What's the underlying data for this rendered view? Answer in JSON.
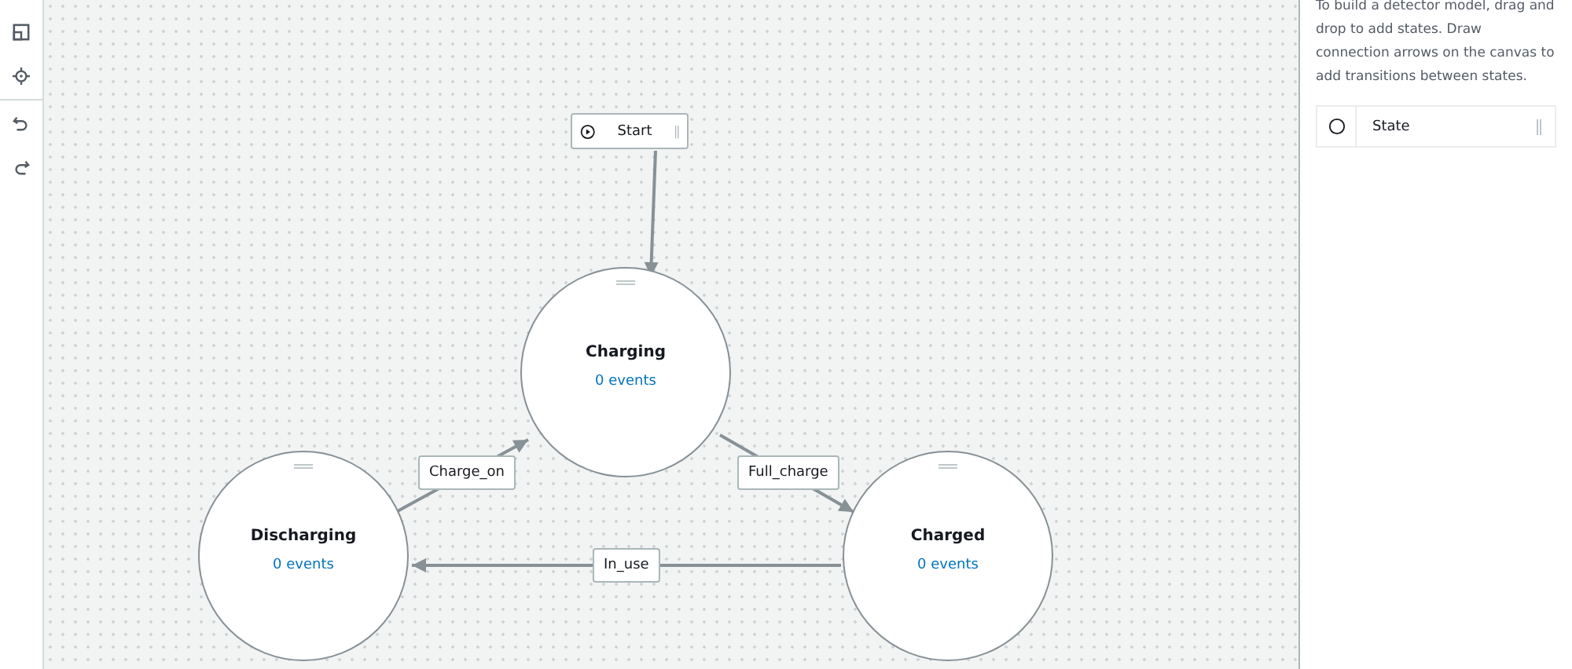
{
  "toolbar": [
    {
      "kind": "fit"
    },
    {
      "kind": "center"
    },
    {
      "kind": "undo"
    },
    {
      "kind": "redo"
    }
  ],
  "canvas": {
    "start": {
      "label": "Start"
    },
    "states": [
      {
        "name": "Charging",
        "events": "0 events"
      },
      {
        "name": "Discharging",
        "events": "0 events"
      },
      {
        "name": "Charged",
        "events": "0 events"
      }
    ],
    "transitions": [
      {
        "label": "Charge_on"
      },
      {
        "label": "Full_charge"
      },
      {
        "label": "In_use"
      }
    ]
  },
  "panel": {
    "help": "To build a detector model, drag and drop to add states. Draw connection arrows on the canvas to add transitions between states.",
    "palette": [
      {
        "label": "State"
      }
    ]
  }
}
